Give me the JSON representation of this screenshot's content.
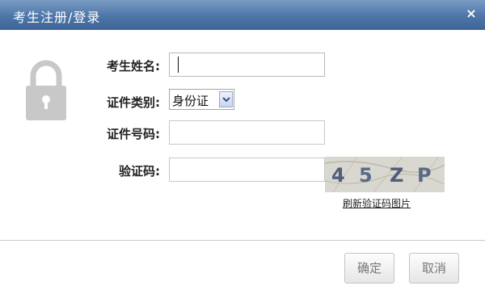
{
  "dialog": {
    "title": "考生注册/登录",
    "close_label": "×"
  },
  "form": {
    "name_label": "考生姓名:",
    "name_value": "",
    "id_type_label": "证件类别:",
    "id_type_selected": "身份证",
    "id_number_label": "证件号码:",
    "id_number_value": "",
    "captcha_label": "验证码:",
    "captcha_value": "",
    "captcha_chars": [
      "4",
      "5",
      "Z",
      "P"
    ],
    "refresh_captcha_label": "刷新验证码图片"
  },
  "footer": {
    "confirm_label": "确定",
    "cancel_label": "取消"
  },
  "icons": {
    "lock": "lock-icon",
    "close": "close-icon",
    "dropdown": "chevron-down-icon"
  },
  "colors": {
    "titlebar": "#4e76a8",
    "lock_gray": "#c8c8c8",
    "button_text": "#777777"
  }
}
